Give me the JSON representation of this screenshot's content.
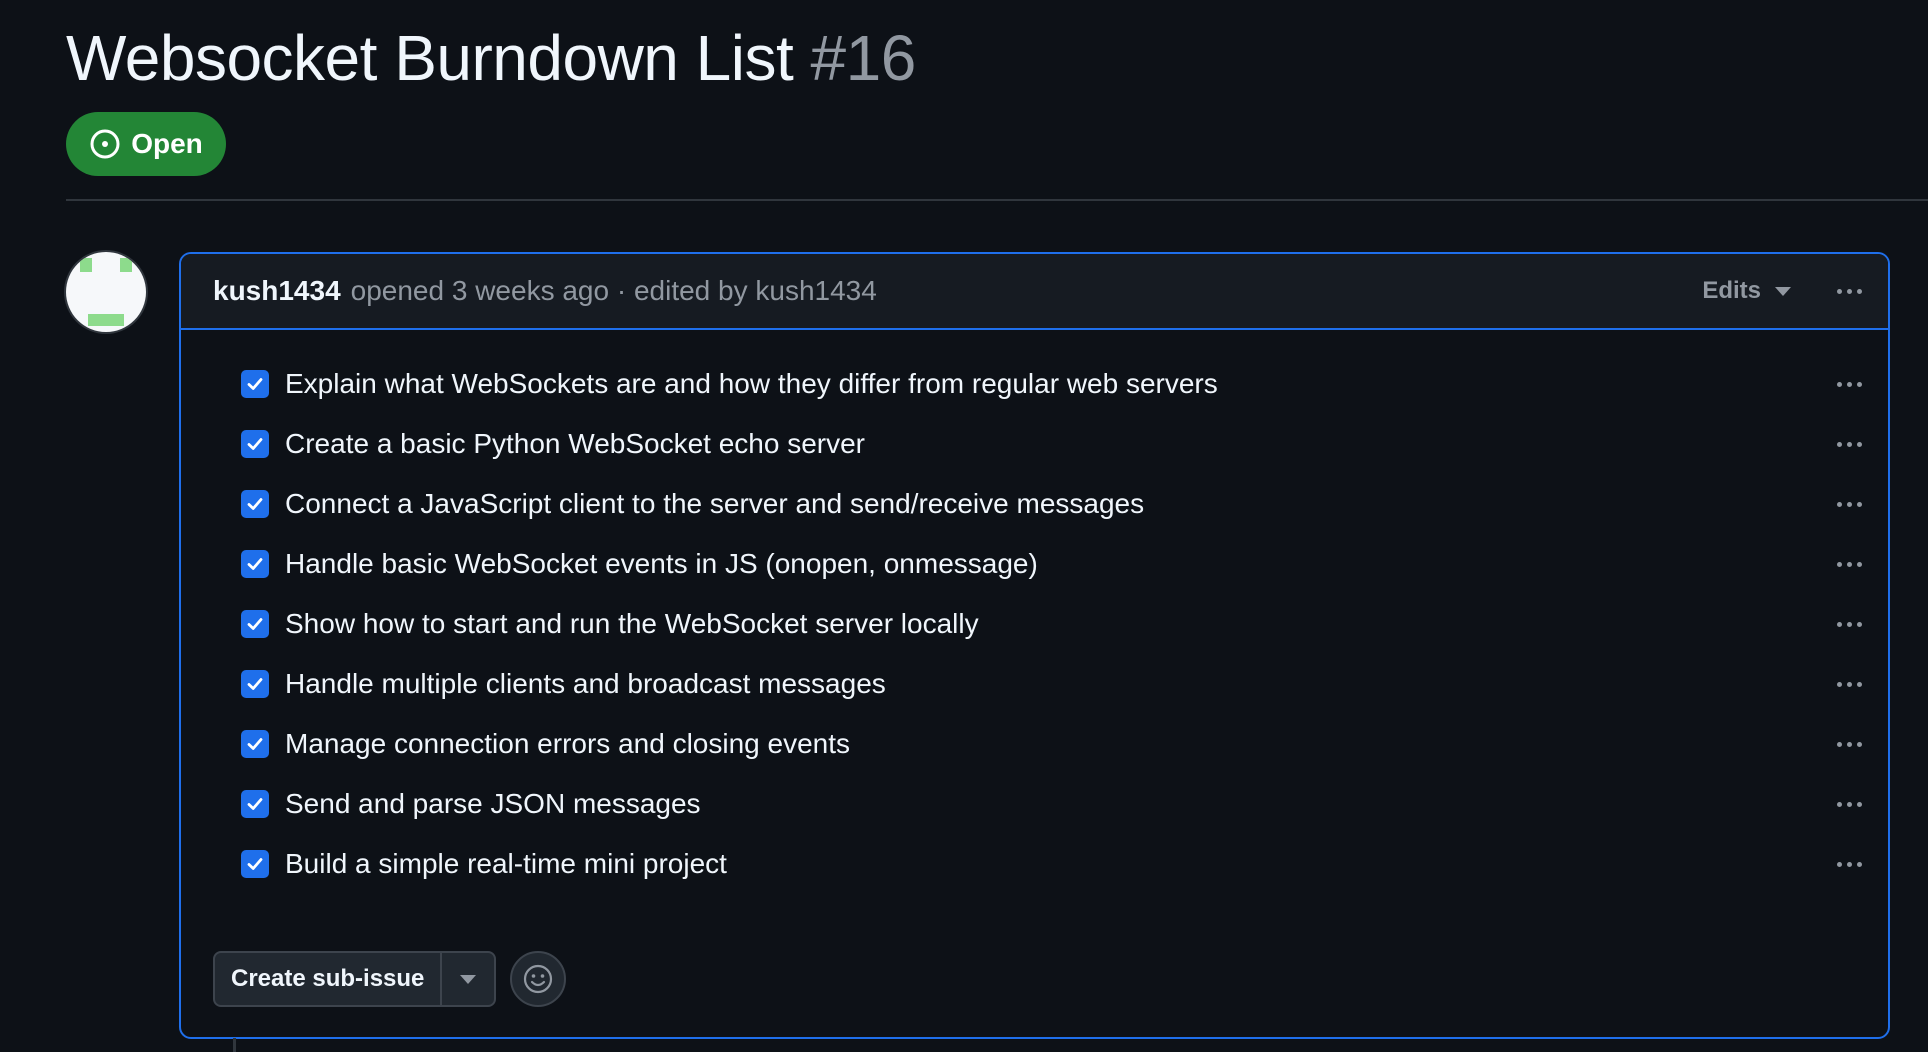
{
  "issue": {
    "title": "Websocket Burndown List",
    "number": "#16",
    "state": "Open",
    "state_color": "#238636"
  },
  "comment": {
    "author": "kush1434",
    "meta": "opened 3 weeks ago · edited by kush1434",
    "edits_label": "Edits",
    "accent_color": "#1f6feb",
    "tasks": [
      {
        "label": "Explain what WebSockets are and how they differ from regular web servers",
        "checked": true
      },
      {
        "label": "Create a basic Python WebSocket echo server",
        "checked": true
      },
      {
        "label": "Connect a JavaScript client to the server and send/receive messages",
        "checked": true
      },
      {
        "label": "Handle basic WebSocket events in JS (onopen, onmessage)",
        "checked": true
      },
      {
        "label": "Show how to start and run the WebSocket server locally",
        "checked": true
      },
      {
        "label": "Handle multiple clients and broadcast messages",
        "checked": true
      },
      {
        "label": "Manage connection errors and closing events",
        "checked": true
      },
      {
        "label": "Send and parse JSON messages",
        "checked": true
      },
      {
        "label": "Build a simple real-time mini project",
        "checked": true
      }
    ],
    "create_sub_issue_label": "Create sub-issue"
  },
  "icons": {
    "state": "issue-opened-icon",
    "checkbox": "checkmark-icon",
    "menu": "kebab-horizontal-icon",
    "dropdown": "triangle-down-icon",
    "reaction": "smiley-icon"
  }
}
